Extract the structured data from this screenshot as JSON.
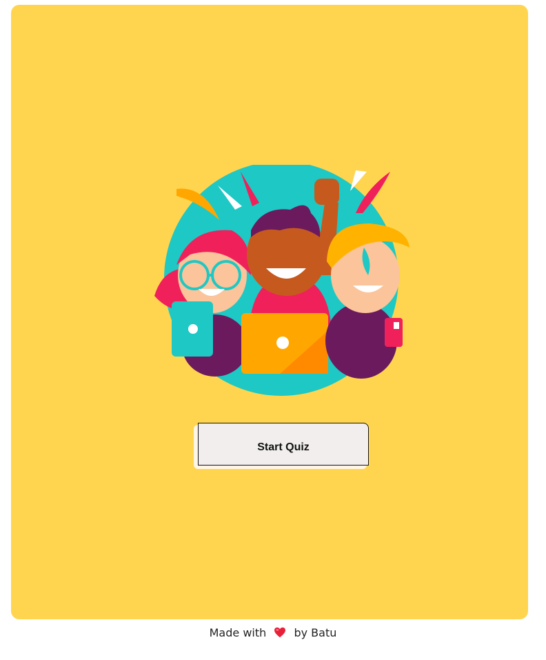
{
  "main": {
    "start_button_label": "Start Quiz"
  },
  "footer": {
    "made_with": "Made with",
    "heart_icon": "heart-icon",
    "by": "by Batu"
  },
  "colors": {
    "background": "#ffd54f",
    "circle": "#1ec8c4",
    "button": "#f3eeee"
  }
}
